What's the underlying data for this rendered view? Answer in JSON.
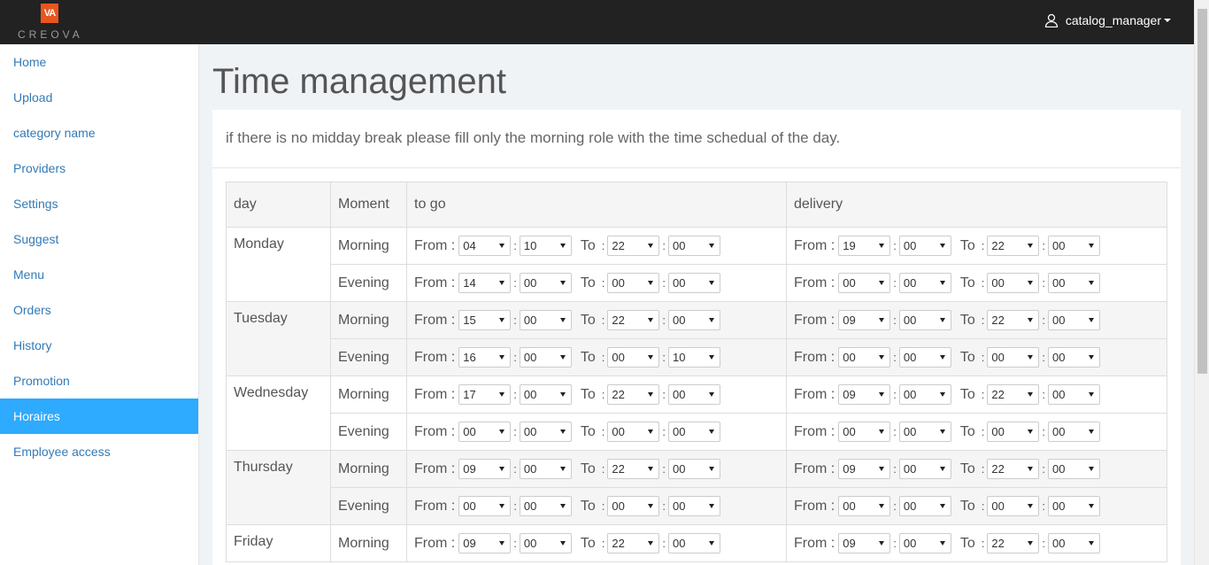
{
  "brand": {
    "mark": "VA",
    "word": "CREOVA"
  },
  "user": {
    "name": "catalog_manager"
  },
  "sidebar": {
    "items": [
      {
        "label": "Home"
      },
      {
        "label": "Upload"
      },
      {
        "label": "category name"
      },
      {
        "label": "Providers"
      },
      {
        "label": "Settings"
      },
      {
        "label": "Suggest"
      },
      {
        "label": "Menu"
      },
      {
        "label": "Orders"
      },
      {
        "label": "History"
      },
      {
        "label": "Promotion"
      },
      {
        "label": "Horaires",
        "active": true
      },
      {
        "label": "Employee access"
      }
    ]
  },
  "page": {
    "title": "Time management",
    "note": "if there is no midday break please fill only the morning role with the time schedual of the day."
  },
  "table": {
    "headers": {
      "day": "day",
      "moment": "Moment",
      "togo": "to go",
      "delivery": "delivery"
    },
    "labels": {
      "from": "From :",
      "to": "To",
      "colon": ":"
    },
    "rows": [
      {
        "day": "Monday",
        "moment": "Morning",
        "togo": [
          "04",
          "10",
          "22",
          "00"
        ],
        "delivery": [
          "19",
          "00",
          "22",
          "00"
        ]
      },
      {
        "day": "",
        "moment": "Evening",
        "togo": [
          "14",
          "00",
          "00",
          "00"
        ],
        "delivery": [
          "00",
          "00",
          "00",
          "00"
        ]
      },
      {
        "day": "Tuesday",
        "moment": "Morning",
        "togo": [
          "15",
          "00",
          "22",
          "00"
        ],
        "delivery": [
          "09",
          "00",
          "22",
          "00"
        ]
      },
      {
        "day": "",
        "moment": "Evening",
        "togo": [
          "16",
          "00",
          "00",
          "10"
        ],
        "delivery": [
          "00",
          "00",
          "00",
          "00"
        ]
      },
      {
        "day": "Wednesday",
        "moment": "Morning",
        "togo": [
          "17",
          "00",
          "22",
          "00"
        ],
        "delivery": [
          "09",
          "00",
          "22",
          "00"
        ]
      },
      {
        "day": "",
        "moment": "Evening",
        "togo": [
          "00",
          "00",
          "00",
          "00"
        ],
        "delivery": [
          "00",
          "00",
          "00",
          "00"
        ]
      },
      {
        "day": "Thursday",
        "moment": "Morning",
        "togo": [
          "09",
          "00",
          "22",
          "00"
        ],
        "delivery": [
          "09",
          "00",
          "22",
          "00"
        ]
      },
      {
        "day": "",
        "moment": "Evening",
        "togo": [
          "00",
          "00",
          "00",
          "00"
        ],
        "delivery": [
          "00",
          "00",
          "00",
          "00"
        ]
      },
      {
        "day": "Friday",
        "moment": "Morning",
        "togo": [
          "09",
          "00",
          "22",
          "00"
        ],
        "delivery": [
          "09",
          "00",
          "22",
          "00"
        ]
      }
    ]
  }
}
